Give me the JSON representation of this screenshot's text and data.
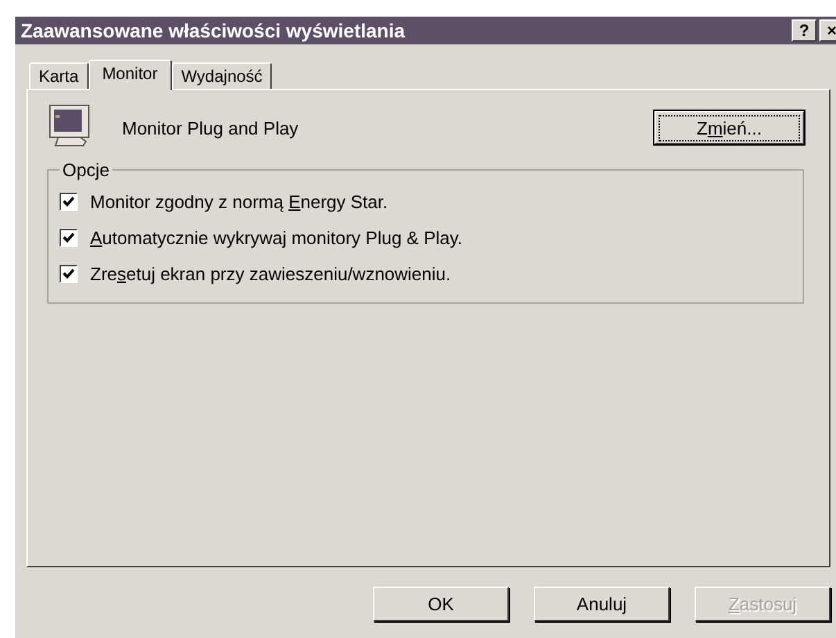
{
  "window": {
    "title": "Zaawansowane właściwości wyświetlania",
    "title_buttons": [
      "?",
      "×"
    ]
  },
  "tabs": [
    {
      "label": "Karta",
      "selected": false
    },
    {
      "label": "Monitor",
      "selected": true
    },
    {
      "label": "Wydajność",
      "selected": false
    }
  ],
  "monitor": {
    "name": "Monitor Plug and Play",
    "change_button": {
      "before": "Z",
      "key": "m",
      "after": "ień..."
    }
  },
  "options": {
    "title": "Opcje",
    "items": [
      {
        "before": "Monitor zgodny z normą ",
        "key": "E",
        "after": "nergy Star.",
        "checked": true
      },
      {
        "key": "A",
        "after": "utomatycznie wykrywaj monitory Plug & Play.",
        "checked": true
      },
      {
        "before": "Zre",
        "key": "s",
        "after": "etuj ekran przy zawieszeniu/wznowieniu.",
        "checked": true
      }
    ]
  },
  "buttons": [
    {
      "label": "OK",
      "disabled": false
    },
    {
      "label": "Anuluj",
      "disabled": false
    },
    {
      "key": "Z",
      "after": "astosuj",
      "disabled": true
    }
  ]
}
